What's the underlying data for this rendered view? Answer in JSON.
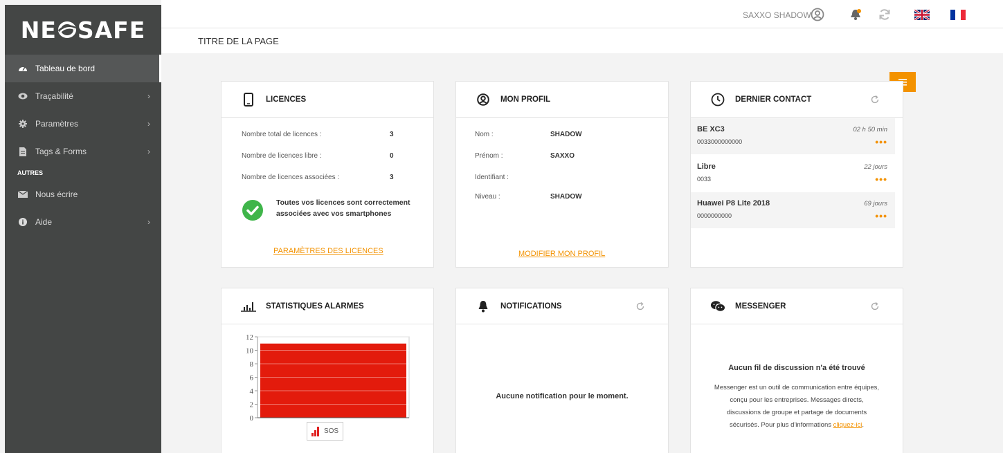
{
  "app": {
    "logo_text_left": "NE",
    "logo_text_right": "SAFE",
    "page_title": "TITRE DE LA PAGE",
    "accent_color": "#f39200"
  },
  "topbar": {
    "user_name": "SAXXO SHADOW",
    "icons": [
      "user-icon",
      "bell-icon",
      "sync-icon",
      "flag-uk",
      "flag-fr"
    ]
  },
  "sidebar": {
    "items": [
      {
        "label": "Tableau de bord",
        "icon": "dashboard-icon",
        "active": true
      },
      {
        "label": "Traçabilité",
        "icon": "eye-icon"
      },
      {
        "label": "Paramètres",
        "icon": "gear-icon"
      },
      {
        "label": "Tags & Forms",
        "icon": "file-icon"
      }
    ],
    "section_label": "AUTRES",
    "other_items": [
      {
        "label": "Nous écrire",
        "icon": "envelope-icon"
      },
      {
        "label": "Aide",
        "icon": "info-icon"
      }
    ]
  },
  "licences": {
    "title": "LICENCES",
    "rows": [
      {
        "label": "Nombre total de licences :",
        "value": "3"
      },
      {
        "label": "Nombre de licences libre :",
        "value": "0"
      },
      {
        "label": "Nombre de licences associées :",
        "value": "3"
      }
    ],
    "status_line1": "Toutes vos licences sont correctement",
    "status_line2": "associées avec vos smartphones",
    "link": "PARAMÈTRES DES LICENCES"
  },
  "profil": {
    "title": "MON PROFIL",
    "rows": [
      {
        "label": "Nom :",
        "value": "SHADOW"
      },
      {
        "label": "Prénom :",
        "value": "SAXXO"
      },
      {
        "label": "Identifiant :",
        "value": ""
      },
      {
        "label": "Niveau :",
        "value": "SHADOW"
      }
    ],
    "link": "MODIFIER MON PROFIL"
  },
  "contact": {
    "title": "DERNIER CONTACT",
    "items": [
      {
        "name": "BE XC3",
        "number": "0033000000000",
        "time": "02 h 50 min",
        "more": "•••"
      },
      {
        "name": "Libre",
        "number": "0033",
        "time": "22 jours",
        "more": "•••"
      },
      {
        "name": "Huawei P8 Lite 2018",
        "number": "0000000000",
        "time": "69 jours",
        "more": "•••"
      }
    ]
  },
  "stats": {
    "title": "STATISTIQUES ALARMES",
    "legend": "SOS"
  },
  "notifications": {
    "title": "NOTIFICATIONS",
    "empty": "Aucune notification pour le moment."
  },
  "messenger": {
    "title": "MESSENGER",
    "empty_title": "Aucun fil de discussion n'a été trouvé",
    "desc_line1": "Messenger est un outil de communication entre équipes,",
    "desc_line2": "conçu pour les entreprises. Messages directs,",
    "desc_line3": "discussions de groupe et partage de documents",
    "desc_line4": "sécurisés. Pour plus d'informations ",
    "desc_link": "cliquez-ici",
    "desc_end": "."
  },
  "chart_data": {
    "type": "bar",
    "categories": [
      "SOS"
    ],
    "series": [
      {
        "name": "SOS",
        "values": [
          11
        ]
      }
    ],
    "yticks": [
      "0",
      "2",
      "4",
      "6",
      "8",
      "10",
      "12"
    ],
    "ylim": [
      0,
      12
    ],
    "bar_color": "#e31b0c",
    "grid": true,
    "legend": "bottom"
  }
}
